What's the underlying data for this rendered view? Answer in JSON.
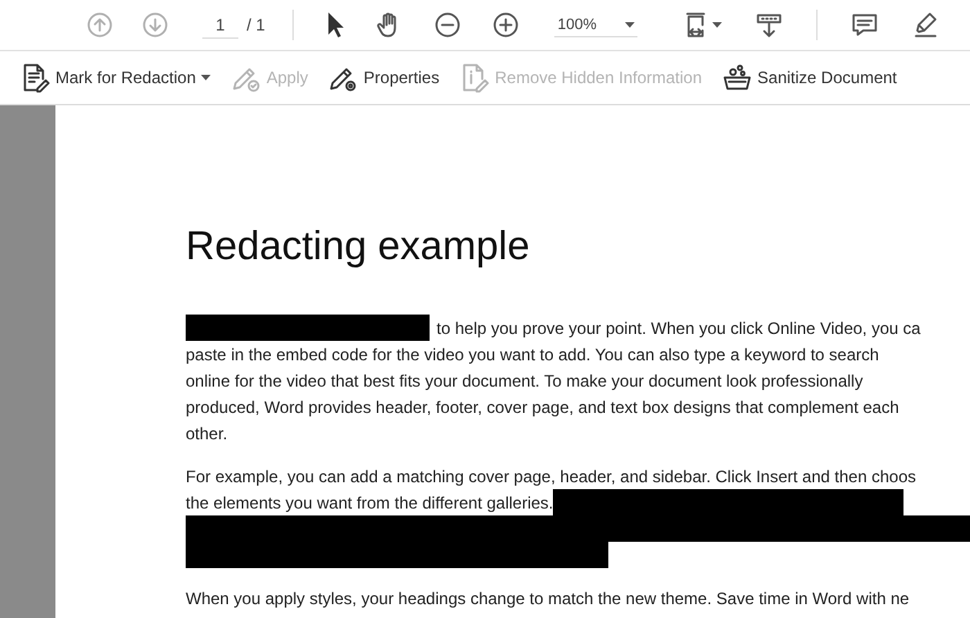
{
  "toolbar": {
    "nav_buttons": [
      {
        "kind": "previous",
        "disabled": true
      },
      {
        "kind": "next",
        "disabled": true
      }
    ],
    "page_field": {
      "value": "1"
    },
    "page_total": "/ 1",
    "tools": [
      {
        "kind": "pointer"
      },
      {
        "kind": "hand"
      },
      {
        "kind": "zoom-out"
      },
      {
        "kind": "zoom-in"
      }
    ],
    "zoom_field": {
      "value": "100%"
    },
    "view_tools": [
      {
        "kind": "fit-page",
        "dropdown": true
      },
      {
        "kind": "scroll",
        "dropdown": false
      }
    ],
    "comment_tools": [
      {
        "kind": "comment"
      },
      {
        "kind": "highlight"
      }
    ]
  },
  "redaction_toolbar": [
    {
      "kind": "mark",
      "label": "Mark for Redaction",
      "disabled": false,
      "dropdown": true
    },
    {
      "kind": "apply",
      "label": "Apply",
      "disabled": true,
      "dropdown": false
    },
    {
      "kind": "properties",
      "label": "Properties",
      "disabled": false,
      "dropdown": false
    },
    {
      "kind": "remove",
      "label": "Remove Hidden Information",
      "disabled": true,
      "dropdown": false
    },
    {
      "kind": "sanitize",
      "label": "Sanitize Document",
      "disabled": false,
      "dropdown": false
    }
  ],
  "document": {
    "title": "Redacting example",
    "paragraphs": [
      [
        [
          {
            "kind": "redacted"
          },
          {
            "kind": "text",
            "text": "to help you prove your point. When you click Online Video, you ca"
          }
        ],
        [
          {
            "kind": "text",
            "text": "paste in the embed code for the video you want to add. You can also type a keyword to search"
          }
        ],
        [
          {
            "kind": "text",
            "text": "online for the video that best fits your document. To make your document look professionally"
          }
        ],
        [
          {
            "kind": "text",
            "text": "produced, Word provides header, footer, cover page, and text box designs that complement each"
          }
        ],
        [
          {
            "kind": "text",
            "text": "other."
          }
        ]
      ],
      [
        [
          {
            "kind": "text",
            "text": "For example, you can add a matching cover page, header, and sidebar. Click Insert and then choos"
          }
        ],
        [
          {
            "kind": "text",
            "text": "the elements you want from the different galleries."
          },
          {
            "kind": "redacted"
          }
        ],
        [
          {
            "kind": "redacted"
          }
        ],
        [
          {
            "kind": "redacted"
          }
        ]
      ],
      [
        [
          {
            "kind": "text",
            "text": "When you apply styles, your headings change to match the new theme. Save time in Word with ne"
          }
        ]
      ]
    ]
  }
}
